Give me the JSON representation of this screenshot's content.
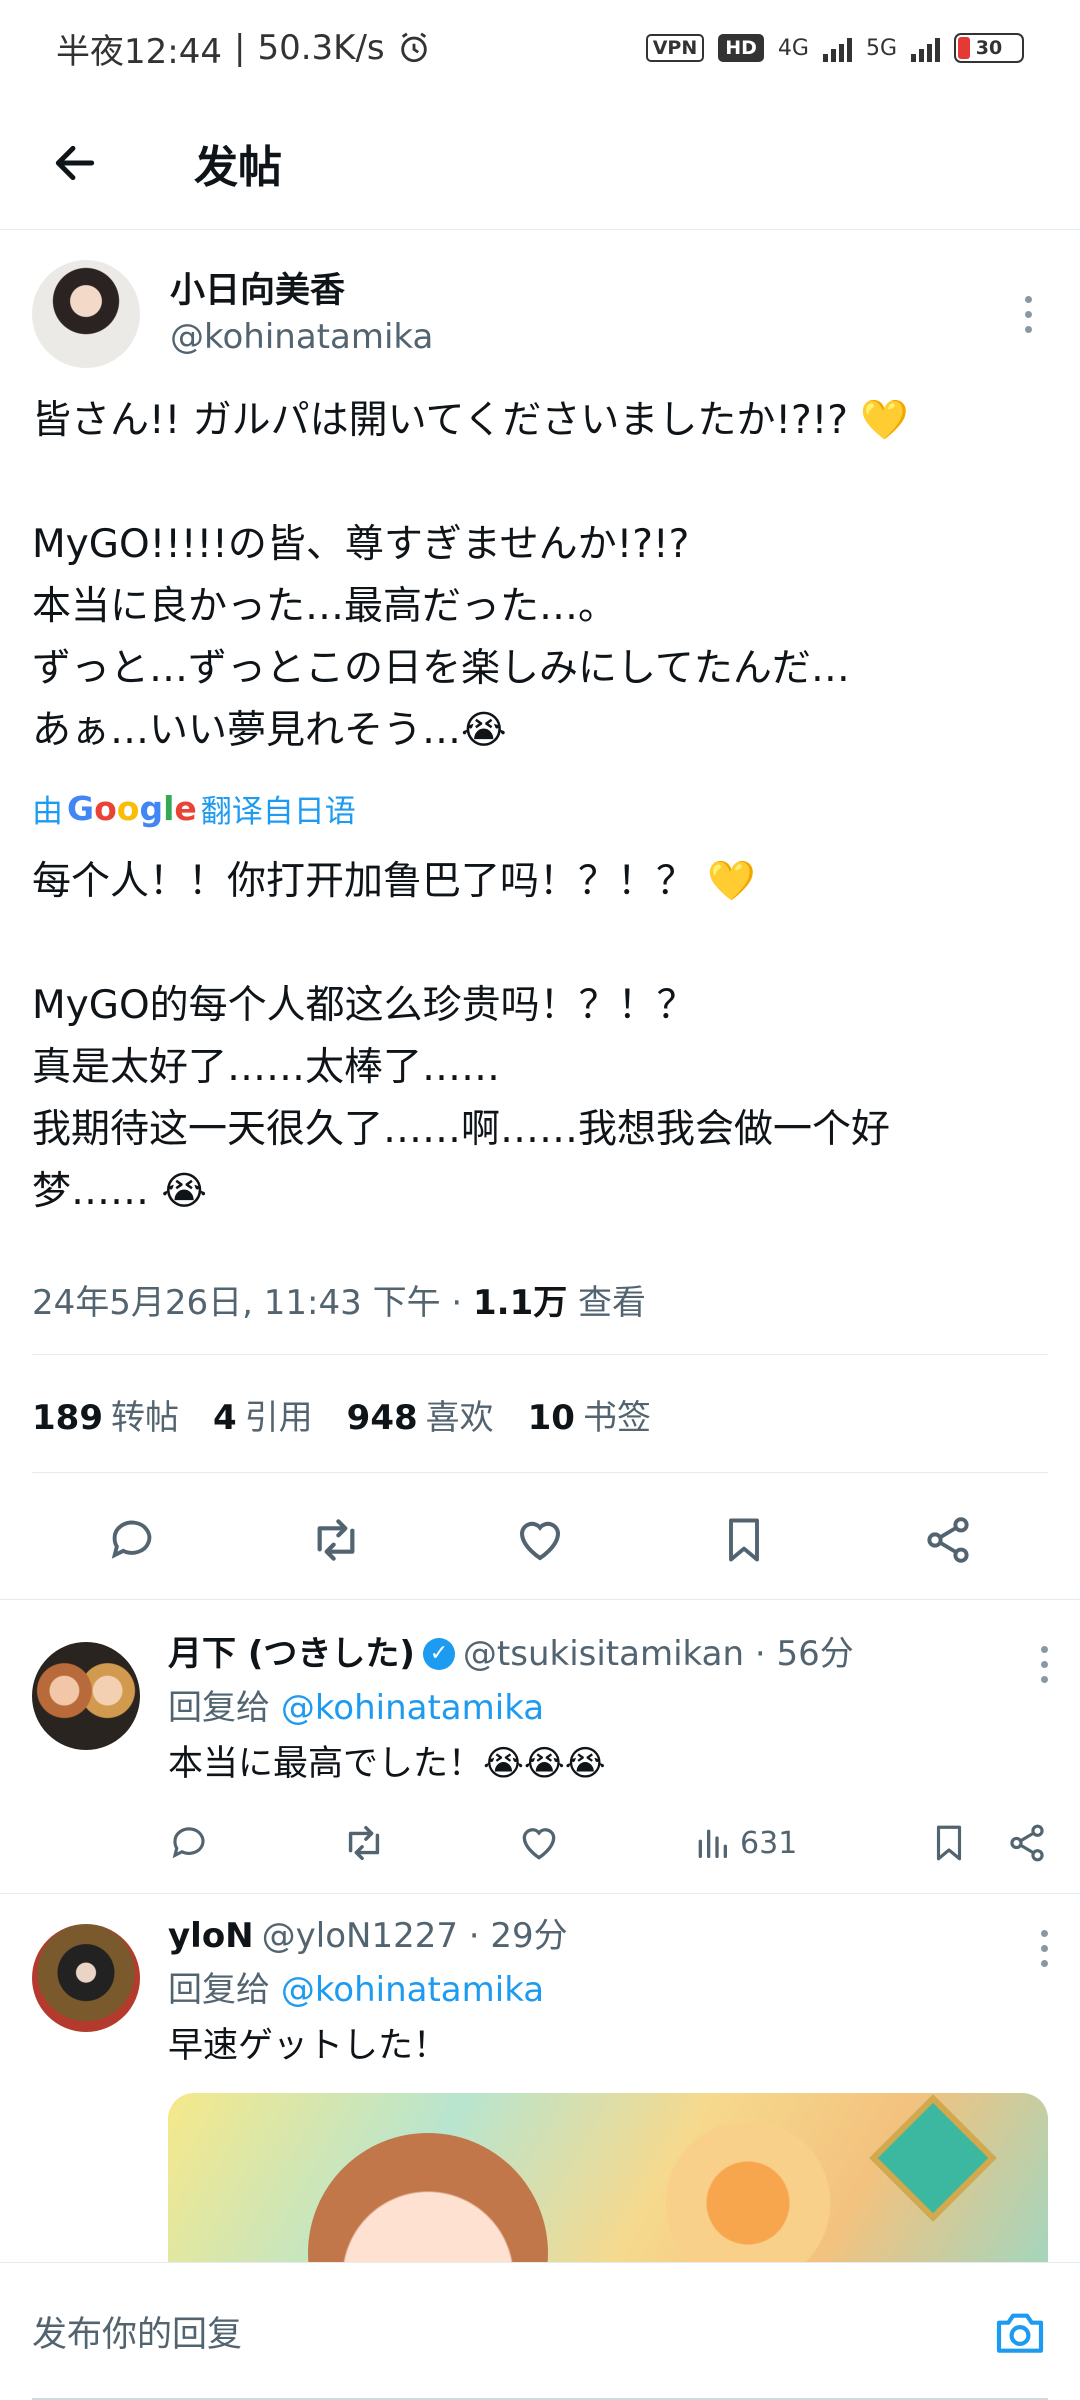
{
  "status_bar": {
    "time": "半夜12:44",
    "speed": "50.3K/s",
    "vpn": "VPN",
    "hd": "HD",
    "net1": "4G",
    "net2": "5G",
    "battery": "30"
  },
  "header": {
    "title": "发帖"
  },
  "tweet": {
    "name": "小日向美香",
    "handle": "@kohinatamika",
    "original": "皆さん!! ガルパは開いてくださいましたか!?!? 💛\n\nMyGO!!!!!の皆、尊すぎませんか!?!?\n本当に良かった…最高だった…。\nずっと…ずっとこの日を楽しみにしてたんだ…\nあぁ…いい夢見れそう…😭",
    "translate_prefix": "由",
    "translate_suffix": "翻译自日语",
    "translated": "每个人！！你打开加鲁巴了吗！？！？ 💛\n\nMyGO的每个人都这么珍贵吗！？！？\n真是太好了……太棒了……\n我期待这一天很久了……啊……我想我会做一个好\n梦…… 😭",
    "timestamp": "24年5月26日, 11:43 下午 · ",
    "views_count": "1.1万",
    "views_label": " 查看"
  },
  "stats": [
    {
      "count": "189",
      "label": "转帖"
    },
    {
      "count": "4",
      "label": "引用"
    },
    {
      "count": "948",
      "label": "喜欢"
    },
    {
      "count": "10",
      "label": "书签"
    }
  ],
  "replies": [
    {
      "name": "月下 (つきした)",
      "handle_time": "@tsukisitamikan · 56分",
      "reply_to_prefix": "回复给",
      "reply_to": "@kohinatamika",
      "text": "本当に最高でした！😭😭😭",
      "views": "631"
    },
    {
      "name": "yloN",
      "handle_time": "@yloN1227 · 29分",
      "reply_to_prefix": "回复给",
      "reply_to": "@kohinatamika",
      "text": "早速ゲットした！"
    }
  ],
  "composer": {
    "placeholder": "发布你的回复"
  },
  "colors": {
    "accent": "#1d9bf0",
    "text": "#0f1419",
    "secondary": "#536471"
  }
}
